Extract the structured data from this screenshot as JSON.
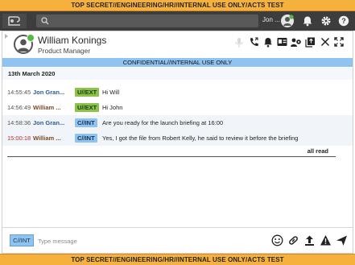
{
  "classification_banner": "TOP SECRET//ENGINEERING/HR//INTERNAL USE ONLY/ACTS TEST",
  "toolbar": {
    "search_placeholder": "",
    "user_name": "Jon ..."
  },
  "contact": {
    "name": "William Konings",
    "role": "Product Manager"
  },
  "conversation_banner": "CONFIDENTIAL//INTERNAL USE ONLY",
  "date_header": "13th March 2020",
  "messages": [
    {
      "time": "14:55:45",
      "sender": "Jon Gran...",
      "classification": "U//EXT",
      "text": "Hi Will"
    },
    {
      "time": "14:56:49",
      "sender": "William ...",
      "classification": "U//EXT",
      "text": "Hi John"
    },
    {
      "time": "14:58:36",
      "sender": "Jon Gran...",
      "classification": "C//INT",
      "text": "Are you ready for the launch briefing at 16:00"
    },
    {
      "time": "15:00:18",
      "sender": "William ...",
      "classification": "C//INT",
      "text": "Yes, I got the file from Robert Kelly, he said to review it before the briefing"
    }
  ],
  "read_status": "all read",
  "composer": {
    "classification": "C//INT",
    "placeholder": "Type message"
  },
  "colors": {
    "banner": "#f6b13c",
    "toolbar": "#3d3d3d",
    "confidential": "#8ec3f2",
    "unclassified": "#8bc34a",
    "presence": "#57b848"
  }
}
